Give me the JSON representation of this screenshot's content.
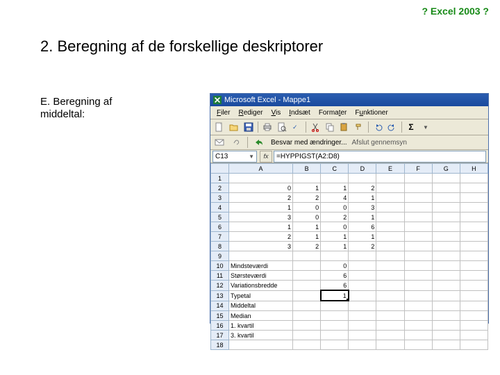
{
  "header": {
    "topright": "? Excel 2003 ?"
  },
  "title": "2. Beregning af de forskellige deskriptorer",
  "sidetext_l1": "E. Beregning af",
  "sidetext_l2": "middeltal:",
  "excel": {
    "title": "Microsoft Excel - Mappe1",
    "menu": {
      "filer": "Filer",
      "rediger": "Rediger",
      "vis": "Vis",
      "indsaet": "Indsæt",
      "formater": "Formater",
      "funktioner": "Funktioner"
    },
    "toolbar_hint": {
      "besvar": "Besvar med ændringer...",
      "afslut": "Afslut gennemsyn"
    },
    "toolbar_sigma": "Σ",
    "formula": {
      "cellref": "C13",
      "fx": "fx",
      "value": "=HYPPIGST(A2:D8)"
    },
    "columns": [
      "",
      "A",
      "B",
      "C",
      "D",
      "E",
      "F",
      "G",
      "H"
    ],
    "rows": [
      {
        "n": "1",
        "A": "",
        "B": "",
        "C": "",
        "D": "",
        "E": "",
        "F": "",
        "G": "",
        "H": ""
      },
      {
        "n": "2",
        "A": "0",
        "B": "1",
        "C": "1",
        "D": "2",
        "E": "",
        "F": "",
        "G": "",
        "H": ""
      },
      {
        "n": "3",
        "A": "2",
        "B": "2",
        "C": "4",
        "D": "1",
        "E": "",
        "F": "",
        "G": "",
        "H": ""
      },
      {
        "n": "4",
        "A": "1",
        "B": "0",
        "C": "0",
        "D": "3",
        "E": "",
        "F": "",
        "G": "",
        "H": ""
      },
      {
        "n": "5",
        "A": "3",
        "B": "0",
        "C": "2",
        "D": "1",
        "E": "",
        "F": "",
        "G": "",
        "H": ""
      },
      {
        "n": "6",
        "A": "1",
        "B": "1",
        "C": "0",
        "D": "6",
        "E": "",
        "F": "",
        "G": "",
        "H": ""
      },
      {
        "n": "7",
        "A": "2",
        "B": "1",
        "C": "1",
        "D": "1",
        "E": "",
        "F": "",
        "G": "",
        "H": ""
      },
      {
        "n": "8",
        "A": "3",
        "B": "2",
        "C": "1",
        "D": "2",
        "E": "",
        "F": "",
        "G": "",
        "H": ""
      },
      {
        "n": "9",
        "A": "",
        "B": "",
        "C": "",
        "D": "",
        "E": "",
        "F": "",
        "G": "",
        "H": ""
      },
      {
        "n": "10",
        "A": "Mindsteværdi",
        "B": "",
        "C": "0",
        "D": "",
        "E": "",
        "F": "",
        "G": "",
        "H": ""
      },
      {
        "n": "11",
        "A": "Størsteværdi",
        "B": "",
        "C": "6",
        "D": "",
        "E": "",
        "F": "",
        "G": "",
        "H": ""
      },
      {
        "n": "12",
        "A": "Variationsbredde",
        "B": "",
        "C": "6",
        "D": "",
        "E": "",
        "F": "",
        "G": "",
        "H": ""
      },
      {
        "n": "13",
        "A": "Typetal",
        "B": "",
        "C": "1",
        "D": "",
        "E": "",
        "F": "",
        "G": "",
        "H": "",
        "sel": true
      },
      {
        "n": "14",
        "A": "Middeltal",
        "B": "",
        "C": "",
        "D": "",
        "E": "",
        "F": "",
        "G": "",
        "H": ""
      },
      {
        "n": "15",
        "A": "Median",
        "B": "",
        "C": "",
        "D": "",
        "E": "",
        "F": "",
        "G": "",
        "H": ""
      },
      {
        "n": "16",
        "A": "1. kvartil",
        "B": "",
        "C": "",
        "D": "",
        "E": "",
        "F": "",
        "G": "",
        "H": ""
      },
      {
        "n": "17",
        "A": "3. kvartil",
        "B": "",
        "C": "",
        "D": "",
        "E": "",
        "F": "",
        "G": "",
        "H": ""
      },
      {
        "n": "18",
        "A": "",
        "B": "",
        "C": "",
        "D": "",
        "E": "",
        "F": "",
        "G": "",
        "H": ""
      }
    ]
  }
}
